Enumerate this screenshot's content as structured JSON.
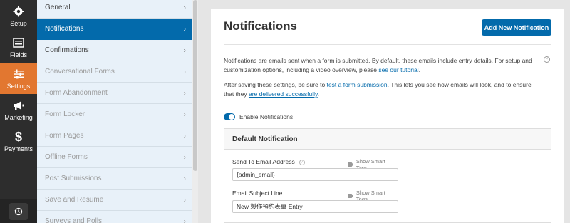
{
  "rail": {
    "items": [
      {
        "label": "Setup",
        "icon": "gear-icon"
      },
      {
        "label": "Fields",
        "icon": "fields-icon"
      },
      {
        "label": "Settings",
        "icon": "sliders-icon",
        "active": true
      },
      {
        "label": "Marketing",
        "icon": "megaphone-icon"
      },
      {
        "label": "Payments",
        "icon": "dollar-icon"
      }
    ],
    "bottom_icon": "history-icon"
  },
  "submenu": {
    "items": [
      {
        "label": "General",
        "state": "enabled"
      },
      {
        "label": "Notifications",
        "state": "active"
      },
      {
        "label": "Confirmations",
        "state": "enabled"
      },
      {
        "label": "Conversational Forms",
        "state": "disabled"
      },
      {
        "label": "Form Abandonment",
        "state": "disabled"
      },
      {
        "label": "Form Locker",
        "state": "disabled"
      },
      {
        "label": "Form Pages",
        "state": "disabled"
      },
      {
        "label": "Offline Forms",
        "state": "disabled"
      },
      {
        "label": "Post Submissions",
        "state": "disabled"
      },
      {
        "label": "Save and Resume",
        "state": "disabled"
      },
      {
        "label": "Surveys and Polls",
        "state": "disabled"
      }
    ],
    "chevron": "›"
  },
  "main": {
    "title": "Notifications",
    "add_button": "Add New Notification",
    "intro": {
      "text": "Notifications are emails sent when a form is submitted. By default, these emails include entry details. For setup and customization options, including a video overview, please ",
      "link": "see our tutorial",
      "end": "."
    },
    "testing": {
      "text1": "After saving these settings, be sure to ",
      "link1": "test a form submission",
      "text2": ". This lets you see how emails will look, and to ensure that they ",
      "link2": "are delivered successfully",
      "end": "."
    },
    "dismiss_symbol": "×",
    "toggle": {
      "label": "Enable Notifications",
      "on": true
    },
    "default_notification": {
      "title": "Default Notification",
      "send_to": {
        "label": "Send To Email Address",
        "value": "{admin_email}",
        "help": "?"
      },
      "subject": {
        "label": "Email Subject Line",
        "value": "New 製作預約表單 Entry"
      },
      "smart_tags": "Show Smart Tags"
    }
  },
  "colors": {
    "accent": "#036aab",
    "rail_bg": "#2d2d2d",
    "rail_active": "#e27730",
    "submenu_bg": "#e8f1f9"
  }
}
